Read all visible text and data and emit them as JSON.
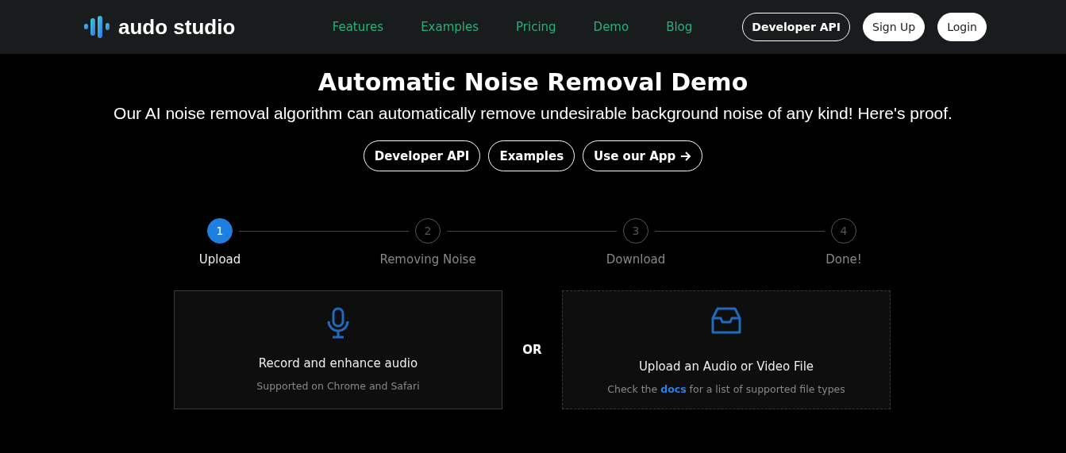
{
  "header": {
    "brand": "audo studio",
    "nav": [
      "Features",
      "Examples",
      "Pricing",
      "Demo",
      "Blog"
    ],
    "buttons": [
      {
        "label": "Developer API",
        "kind": "outline"
      },
      {
        "label": "Sign Up",
        "kind": "filled"
      },
      {
        "label": "Login",
        "kind": "filled"
      }
    ]
  },
  "hero": {
    "title": "Automatic Noise Removal Demo",
    "subtitle": "Our AI noise removal algorithm can automatically remove undesirable background noise of any kind! Here's proof.",
    "buttons": [
      {
        "label": "Developer API",
        "arrow": false
      },
      {
        "label": "Examples",
        "arrow": false
      },
      {
        "label": "Use our App",
        "arrow": true
      }
    ]
  },
  "steps": [
    {
      "number": "1",
      "label": "Upload",
      "selected": true
    },
    {
      "number": "2",
      "label": "Removing Noise",
      "selected": false
    },
    {
      "number": "3",
      "label": "Download",
      "selected": false
    },
    {
      "number": "4",
      "label": "Done!",
      "selected": false
    }
  ],
  "separator": "OR",
  "cards": [
    {
      "kind": "record",
      "title": "Record and enhance audio",
      "hint": "Supported on Chrome and Safari"
    },
    {
      "kind": "upload",
      "title": "Upload an Audio or Video File",
      "hint_before": "Check the",
      "link": "docs",
      "hint_after": "for a list of supported file types"
    }
  ]
}
